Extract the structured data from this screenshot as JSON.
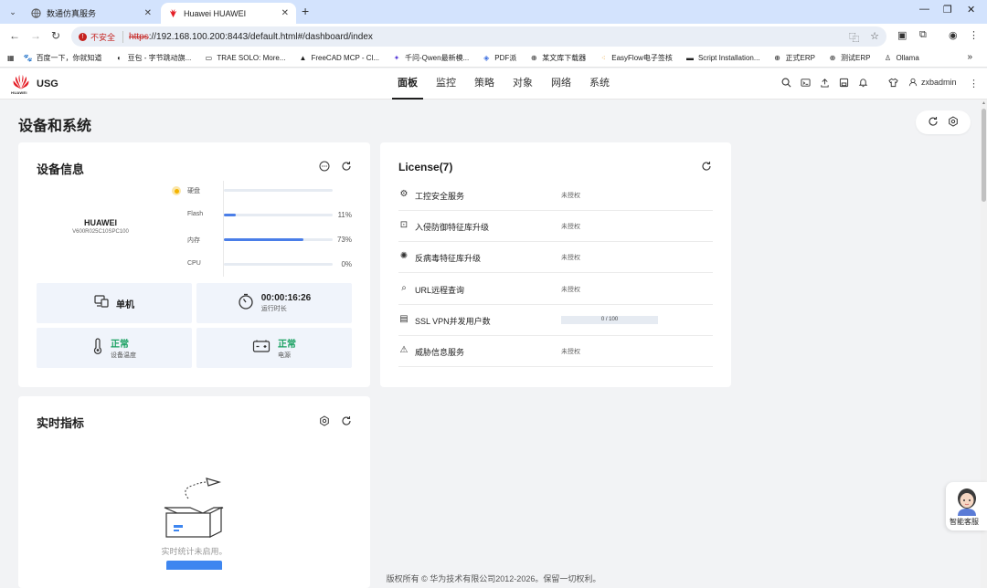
{
  "browser": {
    "tabs": [
      {
        "title": "数通仿真服务",
        "active": false
      },
      {
        "title": "Huawei HUAWEI",
        "active": true
      }
    ],
    "address": {
      "security_label": "不安全",
      "url_protocol": "https",
      "url_rest": "://192.168.100.200:8443/default.html#/dashboard/index"
    },
    "bookmarks": [
      {
        "label": "百度一下，你就知道",
        "icon": "paw-icon"
      },
      {
        "label": "豆包 - 字节跳动旗...",
        "icon": "doubao-icon"
      },
      {
        "label": "TRAE SOLO: More...",
        "icon": "trae-icon"
      },
      {
        "label": "FreeCAD MCP - Cl...",
        "icon": "freecad-icon"
      },
      {
        "label": "千问-Qwen最新模...",
        "icon": "qwen-icon"
      },
      {
        "label": "PDF派",
        "icon": "pdf-icon"
      },
      {
        "label": "某文库下载器",
        "icon": "globe-icon"
      },
      {
        "label": "EasyFlow电子签核",
        "icon": "flow-icon"
      },
      {
        "label": "Script Installation...",
        "icon": "script-icon"
      },
      {
        "label": "正式ERP",
        "icon": "globe-icon"
      },
      {
        "label": "测试ERP",
        "icon": "globe-icon"
      },
      {
        "label": "Ollama",
        "icon": "ollama-icon"
      }
    ]
  },
  "app": {
    "logo_text": "HUAWEI",
    "brand": "USG",
    "nav": [
      "面板",
      "监控",
      "策略",
      "对象",
      "网络",
      "系统"
    ],
    "active_nav": 0,
    "user": "zxbadmin"
  },
  "page": {
    "title": "设备和系统"
  },
  "device": {
    "title": "设备信息",
    "vendor": "HUAWEI",
    "model": "V600R025C10SPC100",
    "resources": [
      {
        "label": "硬盘",
        "percent": null,
        "pct_text": ""
      },
      {
        "label": "Flash",
        "percent": 11,
        "pct_text": "11%"
      },
      {
        "label": "内存",
        "percent": 73,
        "pct_text": "73%"
      },
      {
        "label": "CPU",
        "percent": 0,
        "pct_text": "0%"
      }
    ],
    "tiles": {
      "mode": {
        "value": "单机"
      },
      "uptime": {
        "value": "00:00:16:26",
        "label": "运行时长"
      },
      "temperature": {
        "value": "正常",
        "label": "设备温度"
      },
      "power": {
        "value": "正常",
        "label": "电源"
      }
    }
  },
  "license": {
    "title": "License(7)",
    "items": [
      {
        "name": "工控安全服务",
        "status": "未授权",
        "icon": "gear-icon"
      },
      {
        "name": "入侵防御特征库升级",
        "status": "未授权",
        "icon": "intrusion-icon"
      },
      {
        "name": "反病毒特征库升级",
        "status": "未授权",
        "icon": "virus-icon"
      },
      {
        "name": "URL远程查询",
        "status": "未授权",
        "icon": "url-query-icon"
      },
      {
        "name": "SSL VPN并发用户数",
        "status": "0 / 100",
        "usage": 0,
        "icon": "vpn-icon"
      },
      {
        "name": "威胁信息服务",
        "status": "未授权",
        "icon": "threat-icon"
      }
    ]
  },
  "realtime": {
    "title": "实时指标",
    "empty_text": "实时统计未启用。"
  },
  "footer": "版权所有 © 华为技术有限公司2012-2026。保留一切权利。",
  "assistant": {
    "label": "智能客服"
  },
  "colors": {
    "accent": "#3e86f0",
    "ok": "#1aa162",
    "bar": "#4a7ee8",
    "huawei_red": "#e41c24"
  }
}
